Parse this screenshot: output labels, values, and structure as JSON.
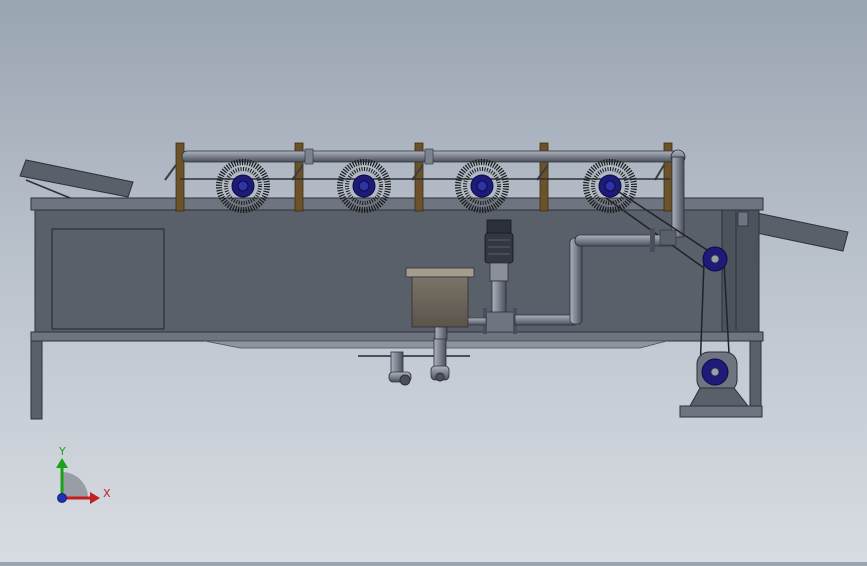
{
  "triad": {
    "y_label": "Y",
    "x_label": "X"
  },
  "colors": {
    "background_top": "#9aa5b2",
    "background_bottom": "#d8dce2",
    "frame_steel": "#4d535d",
    "frame_dark": "#2c3038",
    "tank_face": "#5a606a",
    "pipe": "#7d828f",
    "pipe_dark": "#4a4f5a",
    "wood_post": "#6b5228",
    "brush_hub": "#1e1a7a",
    "bristle": "#1a1a1a",
    "axis_y": "#1aa31a",
    "axis_x": "#c41e1e",
    "axis_z": "#1f2fb8"
  },
  "icons": {
    "coordinate_triad": "xyz-triad-icon",
    "motor": "motor-icon",
    "pump": "pump-icon",
    "brush_roller": "brush-roller-icon"
  }
}
